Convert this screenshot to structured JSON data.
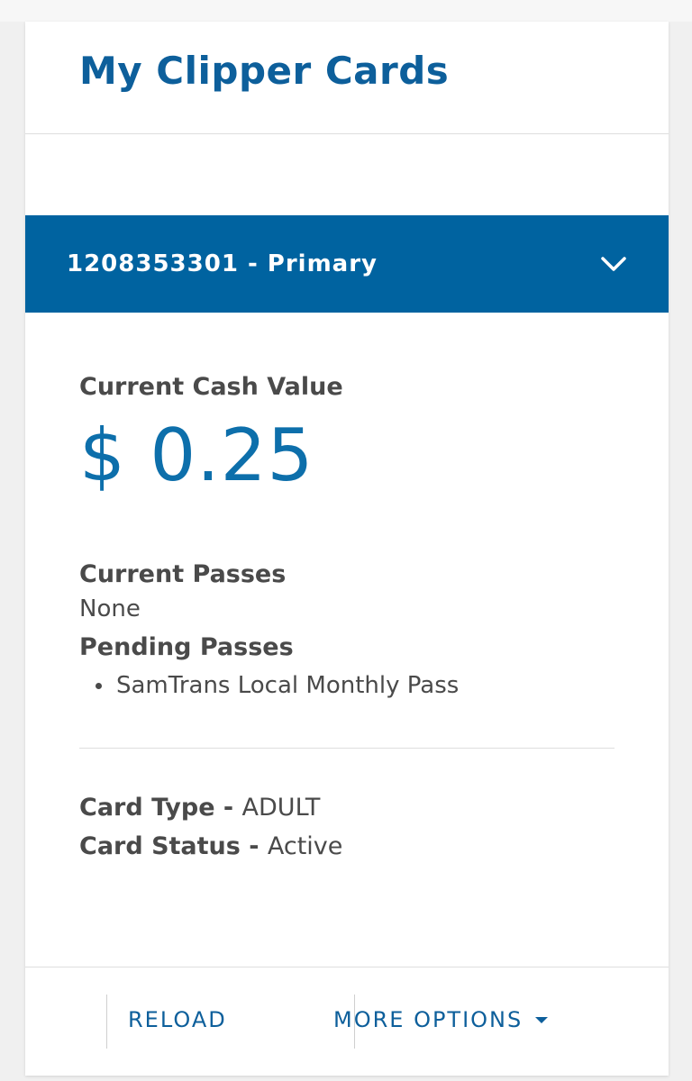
{
  "page": {
    "title": "My Clipper Cards"
  },
  "card": {
    "header": "1208353301 - Primary",
    "cash_label": "Current Cash Value",
    "cash_value": "$ 0.25",
    "current_passes_label": "Current Passes",
    "current_passes_value": "None",
    "pending_passes_label": "Pending Passes",
    "pending_passes": [
      "SamTrans Local Monthly Pass"
    ],
    "type_label": "Card Type - ",
    "type_value": "ADULT",
    "status_label": "Card Status - ",
    "status_value": "Active"
  },
  "footer": {
    "reload_label": "RELOAD",
    "more_options_label": "MORE OPTIONS"
  },
  "icons": {
    "expand": "chevron-down-icon",
    "more_options": "caret-down-icon"
  },
  "colors": {
    "brand_blue": "#0063a0",
    "title_blue": "#0d5f9b",
    "text_gray": "#4a4a4a"
  }
}
